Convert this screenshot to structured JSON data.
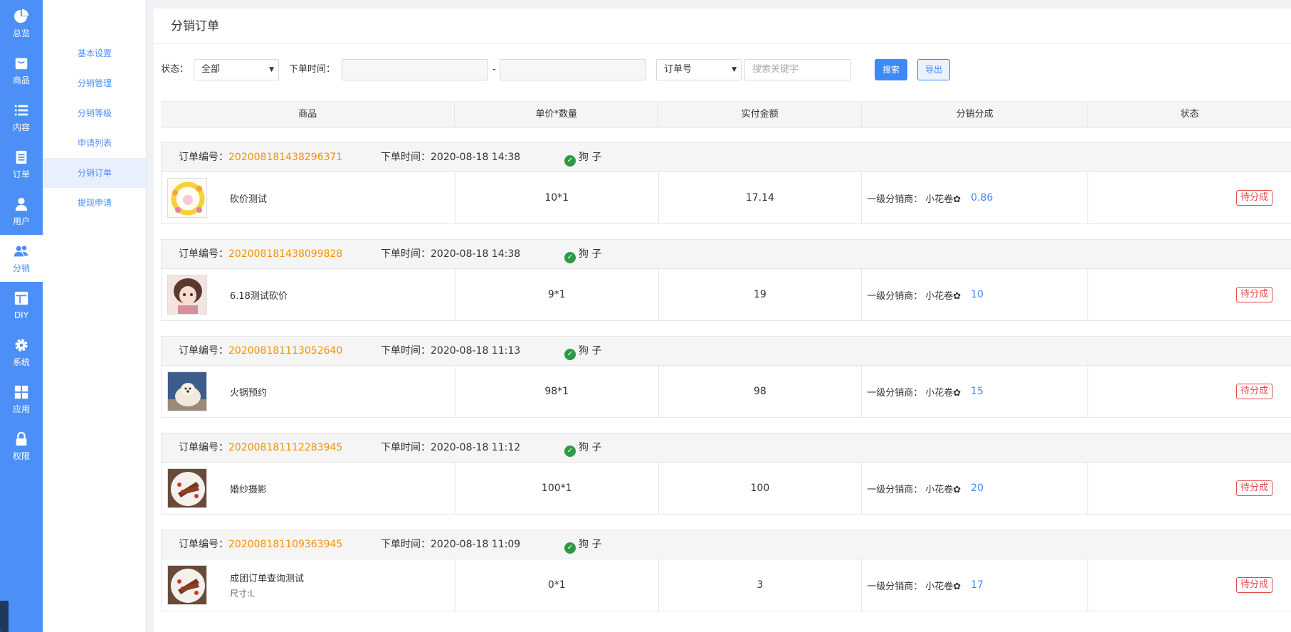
{
  "nav": {
    "items": [
      {
        "label": "总览",
        "icon": "pie-chart-icon"
      },
      {
        "label": "商品",
        "icon": "bag-icon"
      },
      {
        "label": "内容",
        "icon": "list-icon"
      },
      {
        "label": "订单",
        "icon": "document-icon"
      },
      {
        "label": "用户",
        "icon": "user-icon"
      },
      {
        "label": "分销",
        "icon": "users-icon"
      },
      {
        "label": "DIY",
        "icon": "layout-icon"
      },
      {
        "label": "系统",
        "icon": "gear-icon"
      },
      {
        "label": "应用",
        "icon": "grid-icon"
      },
      {
        "label": "权限",
        "icon": "lock-icon"
      }
    ],
    "active": "分销"
  },
  "subnav": {
    "items": [
      "基本设置",
      "分销管理",
      "分销等级",
      "申请列表",
      "分销订单",
      "提现申请"
    ],
    "active": "分销订单"
  },
  "page": {
    "title": "分销订单"
  },
  "filters": {
    "status_label": "状态：",
    "status_value": "全部",
    "time_label": "下单时间：",
    "date_sep": "-",
    "field_value": "订单号",
    "search_placeholder": "搜索关键字",
    "search_btn": "搜索",
    "export_btn": "导出"
  },
  "table": {
    "headers": [
      "商品",
      "单价*数量",
      "实付金额",
      "分销分成",
      "状态"
    ]
  },
  "order_labels": {
    "no": "订单编号：",
    "time": "下单时间：",
    "dist": "一级分销商：",
    "platform_icon": "wechat-miniprogram-icon"
  },
  "orders": [
    {
      "no": "202008181438296371",
      "time": "2020-08-18 14:38",
      "user": "狗 子",
      "product": "砍价测试",
      "spec": "",
      "price_qty": "10*1",
      "paid": "17.14",
      "distributor": "小花卷✿",
      "commission": "0.86",
      "status": "待分成",
      "thumb": "flower-wreath"
    },
    {
      "no": "202008181438099828",
      "time": "2020-08-18 14:38",
      "user": "狗 子",
      "product": "6.18测试砍价",
      "spec": "",
      "price_qty": "9*1",
      "paid": "19",
      "distributor": "小花卷✿",
      "commission": "10",
      "status": "待分成",
      "thumb": "anime-girl"
    },
    {
      "no": "202008181113052640",
      "time": "2020-08-18 11:13",
      "user": "狗 子",
      "product": "火锅预约",
      "spec": "",
      "price_qty": "98*1",
      "paid": "98",
      "distributor": "小花卷✿",
      "commission": "15",
      "status": "待分成",
      "thumb": "dog"
    },
    {
      "no": "202008181112283945",
      "time": "2020-08-18 11:12",
      "user": "狗 子",
      "product": "婚纱摄影",
      "spec": "",
      "price_qty": "100*1",
      "paid": "100",
      "distributor": "小花卷✿",
      "commission": "20",
      "status": "待分成",
      "thumb": "steak"
    },
    {
      "no": "202008181109363945",
      "time": "2020-08-18 11:09",
      "user": "狗 子",
      "product": "成团订单查询测试",
      "spec": "尺寸:L",
      "price_qty": "0*1",
      "paid": "3",
      "distributor": "小花卷✿",
      "commission": "17",
      "status": "待分成",
      "thumb": "steak"
    }
  ]
}
